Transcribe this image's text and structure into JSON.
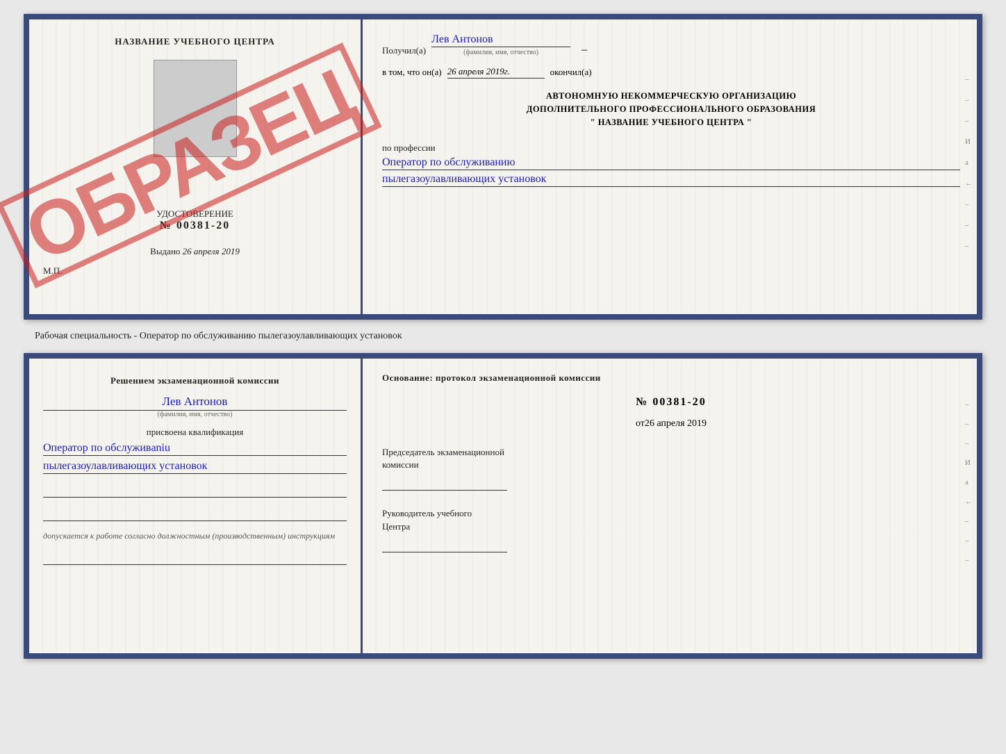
{
  "page": {
    "background": "#e8e8e8"
  },
  "doc1": {
    "left": {
      "center_title": "НАЗВАНИЕ УЧЕБНОГО ЦЕНТРА",
      "stamp": "ОБРАЗЕЦ",
      "cert_label": "УДОСТОВЕРЕНИЕ",
      "cert_number_prefix": "№",
      "cert_number": "00381-20",
      "issued_label": "Выдано",
      "issued_date": "26 апреля 2019",
      "mp_label": "М.П."
    },
    "right": {
      "recipient_prefix": "Получил(а)",
      "recipient_name": "Лев Антонов",
      "fio_label": "(фамилия, имя, отчество)",
      "date_prefix": "в том, что он(а)",
      "date_value": "26 апреля 2019г.",
      "date_suffix": "окончил(а)",
      "org_line1": "АВТОНОМНУЮ НЕКОММЕРЧЕСКУЮ ОРГАНИЗАЦИЮ",
      "org_line2": "ДОПОЛНИТЕЛЬНОГО ПРОФЕССИОНАЛЬНОГО ОБРАЗОВАНИЯ",
      "org_line3": "\"  НАЗВАНИЕ УЧЕБНОГО ЦЕНТРА  \"",
      "profession_label": "по профессии",
      "profession_line1": "Оператор по обслуживанию",
      "profession_line2": "пылегазоулавливающих установок",
      "side_marks": [
        "-",
        "-",
        "-",
        "И",
        "а",
        "←",
        "-",
        "-",
        "-"
      ]
    }
  },
  "middle_label": "Рабочая специальность - Оператор по обслуживанию пылегазоулавливающих установок",
  "doc2": {
    "left": {
      "commission_title": "Решением экзаменационной комиссии",
      "person_name": "Лев Антонов",
      "fio_label": "(фамилия, имя, отчество)",
      "qualification_label": "присвоена квалификация",
      "qualification_line1": "Оператор по обслуживaniu",
      "qualification_line2": "пылегазоулавливающих установок",
      "допуск_text": "допускается к  работе согласно должностным (производственным) инструкциям"
    },
    "right": {
      "basis_label": "Основание: протокол экзаменационной комиссии",
      "protocol_number": "№  00381-20",
      "protocol_date_prefix": "от",
      "protocol_date": "26 апреля 2019",
      "chairman_label1": "Председатель экзаменационной",
      "chairman_label2": "комиссии",
      "director_label1": "Руководитель учебного",
      "director_label2": "Центра",
      "side_marks": [
        "-",
        "-",
        "-",
        "И",
        "а",
        "←",
        "-",
        "-",
        "-"
      ]
    }
  }
}
